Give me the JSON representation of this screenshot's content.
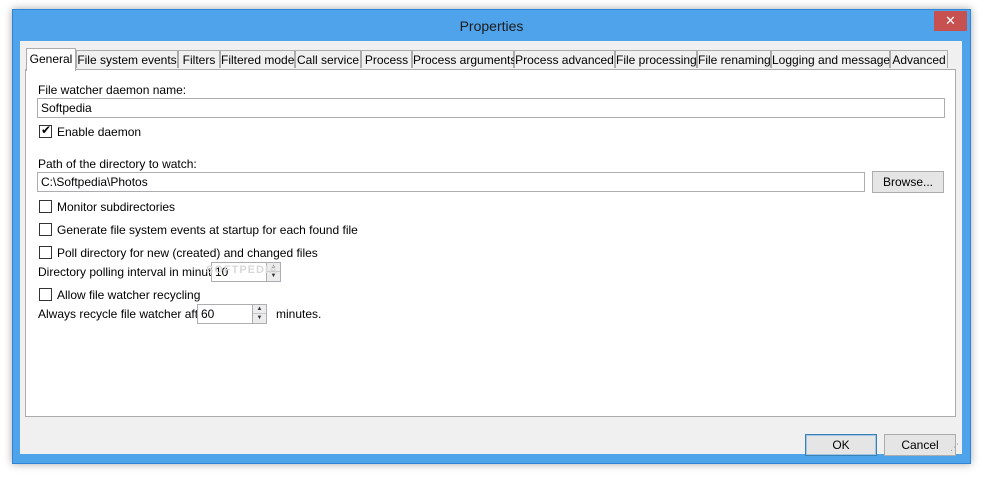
{
  "window": {
    "title": "Properties",
    "close_glyph": "✕"
  },
  "tabs": [
    "General",
    "File system events",
    "Filters",
    "Filtered mode",
    "Call service",
    "Process",
    "Process arguments",
    "Process advanced",
    "File processing",
    "File renaming",
    "Logging and messages",
    "Advanced"
  ],
  "general": {
    "daemon_name_label": "File watcher daemon name:",
    "daemon_name_value": "Softpedia",
    "enable_daemon_label": "Enable daemon",
    "enable_daemon_checked": true,
    "path_label": "Path of the directory to watch:",
    "path_value": "C:\\Softpedia\\Photos",
    "browse_label": "Browse...",
    "monitor_subdirs_label": "Monitor subdirectories",
    "generate_events_label": "Generate file system events at startup for each found file",
    "poll_directory_label": "Poll directory for new (created) and changed files",
    "polling_interval_label": "Directory polling interval in minutes:",
    "polling_interval_value": "10",
    "allow_recycling_label": "Allow file watcher recycling",
    "recycle_after_label": "Always recycle file watcher after",
    "recycle_after_value": "60",
    "minutes_label": "minutes."
  },
  "footer": {
    "ok_label": "OK",
    "cancel_label": "Cancel"
  },
  "watermark": "SOFTPEDIA",
  "colors": {
    "titlebar": "#4fa3ea",
    "close": "#c75050",
    "face": "#f0f0f0"
  }
}
